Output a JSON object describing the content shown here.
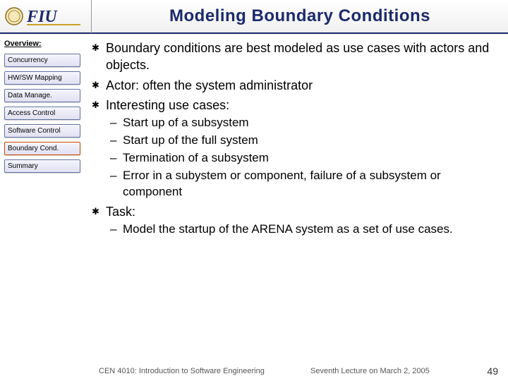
{
  "header": {
    "title": "Modeling Boundary Conditions",
    "logo_initials": "FIU"
  },
  "sidebar": {
    "heading": "Overview:",
    "items": [
      {
        "label": "Concurrency",
        "active": false
      },
      {
        "label": "HW/SW Mapping",
        "active": false
      },
      {
        "label": "Data Manage.",
        "active": false
      },
      {
        "label": "Access Control",
        "active": false
      },
      {
        "label": "Software Control",
        "active": false
      },
      {
        "label": "Boundary Cond.",
        "active": true
      },
      {
        "label": "Summary",
        "active": false
      }
    ]
  },
  "content": {
    "bullets": [
      {
        "text": "Boundary conditions are best modeled as use cases with actors and objects."
      },
      {
        "text": "Actor: often the system administrator"
      },
      {
        "text": "Interesting use cases:",
        "sub": [
          "Start up of a subsystem",
          "Start up of the full system",
          "Termination of a subsystem",
          "Error in a subystem or component, failure of a subsystem or component"
        ]
      },
      {
        "text": "Task:",
        "sub": [
          "Model the startup of the ARENA system as a set of use cases."
        ]
      }
    ]
  },
  "footer": {
    "left": "CEN 4010: Introduction to Software Engineering",
    "center": "Seventh Lecture on March 2, 2005",
    "right": "49"
  }
}
